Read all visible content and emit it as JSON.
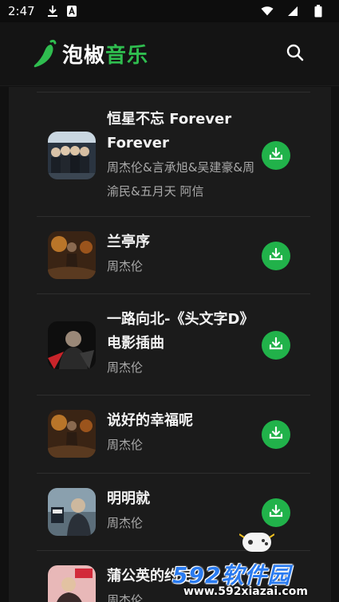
{
  "status_bar": {
    "time": "2:47",
    "icons_left": [
      "download-icon",
      "a-icon"
    ],
    "icons_right": [
      "wifi-icon",
      "cell-signal-icon",
      "battery-icon"
    ]
  },
  "app_bar": {
    "logo_part1": "泡椒",
    "logo_part2": "音乐",
    "logo_icon": "chili-pepper-icon",
    "search_icon": "search-icon"
  },
  "colors": {
    "accent_green": "#21b24a",
    "logo_green": "#2fbd4f",
    "background": "#111111",
    "panel": "#1b1b1b"
  },
  "songs": [
    {
      "title": "恒星不忘 Forever Forever",
      "artist": "周杰伦&言承旭&吴建豪&周渝民&五月天 阿信",
      "cover": "group-photo-cover"
    },
    {
      "title": "兰亭序",
      "artist": "周杰伦",
      "cover": "warm-cover"
    },
    {
      "title": "一路向北-《头文字D》电影插曲",
      "artist": "周杰伦",
      "cover": "dark-portrait-cover"
    },
    {
      "title": "说好的幸福呢",
      "artist": "周杰伦",
      "cover": "warm-cover"
    },
    {
      "title": "明明就",
      "artist": "周杰伦",
      "cover": "blue-grey-cover"
    },
    {
      "title": "蒲公英的约定",
      "artist": "周杰伦",
      "cover": "pink-cover"
    }
  ],
  "watermark": {
    "brand": "592软件园",
    "url": "www.592xiazai.com"
  }
}
